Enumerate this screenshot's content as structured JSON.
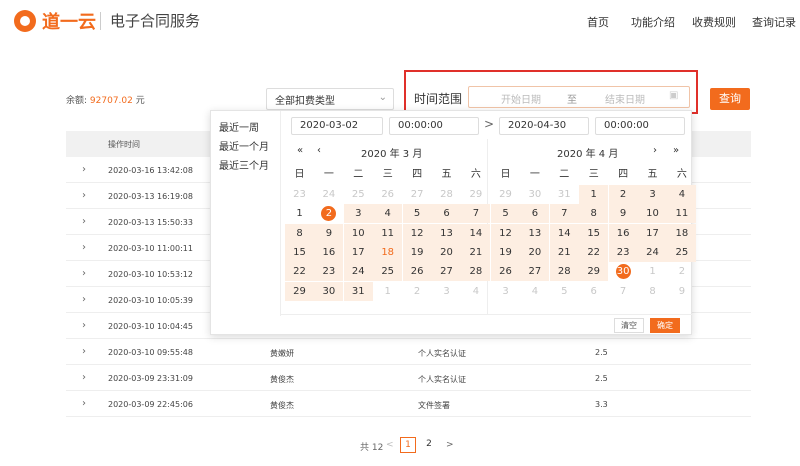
{
  "header": {
    "logo_text": "道一云",
    "product": "电子合同服务",
    "nav": [
      "首页",
      "功能介绍",
      "收费规则",
      "查询记录"
    ]
  },
  "toolbar": {
    "balance_label": "余额:",
    "balance_value": "92707.02",
    "balance_unit": "元",
    "fee_type": "全部扣费类型",
    "range_label": "时间范围",
    "start_placeholder": "开始日期",
    "range_to": "至",
    "end_placeholder": "结束日期",
    "query_label": "查询"
  },
  "table": {
    "header_time": "操作时间",
    "rows": [
      {
        "time": "2020-03-16 13:42:08",
        "user": "",
        "type": "",
        "amount": ""
      },
      {
        "time": "2020-03-13 16:19:08",
        "user": "",
        "type": "",
        "amount": ""
      },
      {
        "time": "2020-03-13 15:50:33",
        "user": "",
        "type": "",
        "amount": ""
      },
      {
        "time": "2020-03-10 11:00:11",
        "user": "",
        "type": "",
        "amount": ""
      },
      {
        "time": "2020-03-10 10:53:12",
        "user": "",
        "type": "",
        "amount": ""
      },
      {
        "time": "2020-03-10 10:05:39",
        "user": "",
        "type": "",
        "amount": ""
      },
      {
        "time": "2020-03-10 10:04:45",
        "user": "",
        "type": "",
        "amount": ""
      },
      {
        "time": "2020-03-10 09:55:48",
        "user": "黄嫩妍",
        "type": "个人实名认证",
        "amount": "2.5"
      },
      {
        "time": "2020-03-09 23:31:09",
        "user": "黄俊杰",
        "type": "个人实名认证",
        "amount": "2.5"
      },
      {
        "time": "2020-03-09 22:45:06",
        "user": "黄俊杰",
        "type": "文件签署",
        "amount": "3.3"
      }
    ]
  },
  "pagination": {
    "total": "共 12",
    "pages": [
      "1",
      "2"
    ],
    "current": "1"
  },
  "picker": {
    "shortcuts": [
      "最近一周",
      "最近一个月",
      "最近三个月"
    ],
    "start_date": "2020-03-02",
    "start_time": "00:00:00",
    "end_date": "2020-04-30",
    "end_time": "00:00:00",
    "weekdays": [
      "日",
      "一",
      "二",
      "三",
      "四",
      "五",
      "六"
    ],
    "left_title": "2020 年 3 月",
    "right_title": "2020 年 4 月",
    "left_days": [
      {
        "d": "23",
        "k": "oth"
      },
      {
        "d": "24",
        "k": "oth"
      },
      {
        "d": "25",
        "k": "oth"
      },
      {
        "d": "26",
        "k": "oth"
      },
      {
        "d": "27",
        "k": "oth"
      },
      {
        "d": "28",
        "k": "oth"
      },
      {
        "d": "29",
        "k": "oth"
      },
      {
        "d": "1",
        "k": ""
      },
      {
        "d": "2",
        "k": "sel"
      },
      {
        "d": "3",
        "k": "in"
      },
      {
        "d": "4",
        "k": "in"
      },
      {
        "d": "5",
        "k": "in"
      },
      {
        "d": "6",
        "k": "in"
      },
      {
        "d": "7",
        "k": "in"
      },
      {
        "d": "8",
        "k": "in"
      },
      {
        "d": "9",
        "k": "in"
      },
      {
        "d": "10",
        "k": "in"
      },
      {
        "d": "11",
        "k": "in"
      },
      {
        "d": "12",
        "k": "in"
      },
      {
        "d": "13",
        "k": "in"
      },
      {
        "d": "14",
        "k": "in"
      },
      {
        "d": "15",
        "k": "in"
      },
      {
        "d": "16",
        "k": "in"
      },
      {
        "d": "17",
        "k": "in"
      },
      {
        "d": "18",
        "k": "today"
      },
      {
        "d": "19",
        "k": "in"
      },
      {
        "d": "20",
        "k": "in"
      },
      {
        "d": "21",
        "k": "in"
      },
      {
        "d": "22",
        "k": "in"
      },
      {
        "d": "23",
        "k": "in"
      },
      {
        "d": "24",
        "k": "in"
      },
      {
        "d": "25",
        "k": "in"
      },
      {
        "d": "26",
        "k": "in"
      },
      {
        "d": "27",
        "k": "in"
      },
      {
        "d": "28",
        "k": "in"
      },
      {
        "d": "29",
        "k": "in"
      },
      {
        "d": "30",
        "k": "in"
      },
      {
        "d": "31",
        "k": "in"
      },
      {
        "d": "1",
        "k": "oth"
      },
      {
        "d": "2",
        "k": "oth"
      },
      {
        "d": "3",
        "k": "oth"
      },
      {
        "d": "4",
        "k": "oth"
      }
    ],
    "right_days": [
      {
        "d": "29",
        "k": "oth"
      },
      {
        "d": "30",
        "k": "oth"
      },
      {
        "d": "31",
        "k": "oth"
      },
      {
        "d": "1",
        "k": "in"
      },
      {
        "d": "2",
        "k": "in"
      },
      {
        "d": "3",
        "k": "in"
      },
      {
        "d": "4",
        "k": "in"
      },
      {
        "d": "5",
        "k": "in"
      },
      {
        "d": "6",
        "k": "in"
      },
      {
        "d": "7",
        "k": "in"
      },
      {
        "d": "8",
        "k": "in"
      },
      {
        "d": "9",
        "k": "in"
      },
      {
        "d": "10",
        "k": "in"
      },
      {
        "d": "11",
        "k": "in"
      },
      {
        "d": "12",
        "k": "in"
      },
      {
        "d": "13",
        "k": "in"
      },
      {
        "d": "14",
        "k": "in"
      },
      {
        "d": "15",
        "k": "in"
      },
      {
        "d": "16",
        "k": "in"
      },
      {
        "d": "17",
        "k": "in"
      },
      {
        "d": "18",
        "k": "in"
      },
      {
        "d": "19",
        "k": "in"
      },
      {
        "d": "20",
        "k": "in"
      },
      {
        "d": "21",
        "k": "in"
      },
      {
        "d": "22",
        "k": "in"
      },
      {
        "d": "23",
        "k": "in"
      },
      {
        "d": "24",
        "k": "in"
      },
      {
        "d": "25",
        "k": "in"
      },
      {
        "d": "26",
        "k": "in"
      },
      {
        "d": "27",
        "k": "in"
      },
      {
        "d": "28",
        "k": "in"
      },
      {
        "d": "29",
        "k": "in"
      },
      {
        "d": "30",
        "k": "sel"
      },
      {
        "d": "1",
        "k": "oth"
      },
      {
        "d": "2",
        "k": "oth"
      },
      {
        "d": "3",
        "k": "oth"
      },
      {
        "d": "4",
        "k": "oth"
      },
      {
        "d": "5",
        "k": "oth"
      },
      {
        "d": "6",
        "k": "oth"
      },
      {
        "d": "7",
        "k": "oth"
      },
      {
        "d": "8",
        "k": "oth"
      },
      {
        "d": "9",
        "k": "oth"
      }
    ],
    "clear_label": "清空",
    "ok_label": "确定"
  },
  "colors": {
    "accent": "#f26b1d",
    "highlight_border": "#e0302a",
    "range_fill": "#fdeee2"
  }
}
